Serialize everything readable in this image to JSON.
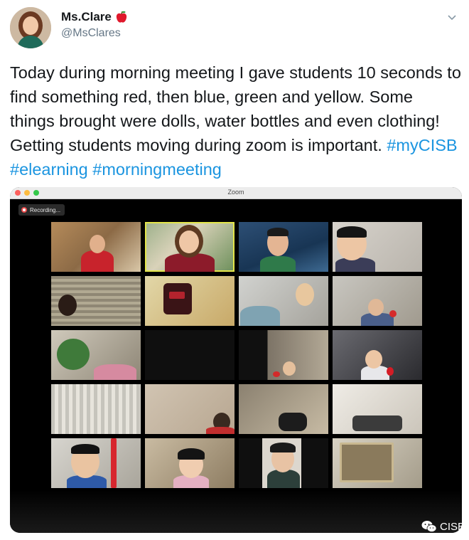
{
  "tweet": {
    "author_name": "Ms.Clare",
    "author_handle": "@MsClares",
    "name_badge_icon": "red-apple-icon",
    "menu_icon": "chevron-down-icon",
    "text": "Today during morning meeting I gave students 10 seconds to find something red, then blue, green and yellow. Some things brought were dolls, water bottles and even clothing! Getting students moving during zoom is important.",
    "hashtags": "#myCISB #elearning #morningmeeting"
  },
  "zoom": {
    "window_title": "Zoom",
    "recording_label": "Recording...",
    "traffic_lights": [
      "#fc605c",
      "#fdbc40",
      "#34c84a"
    ],
    "active_speaker_border": "#e3e54a"
  },
  "watermark": {
    "icon": "wechat-icon",
    "label": "CISB"
  }
}
